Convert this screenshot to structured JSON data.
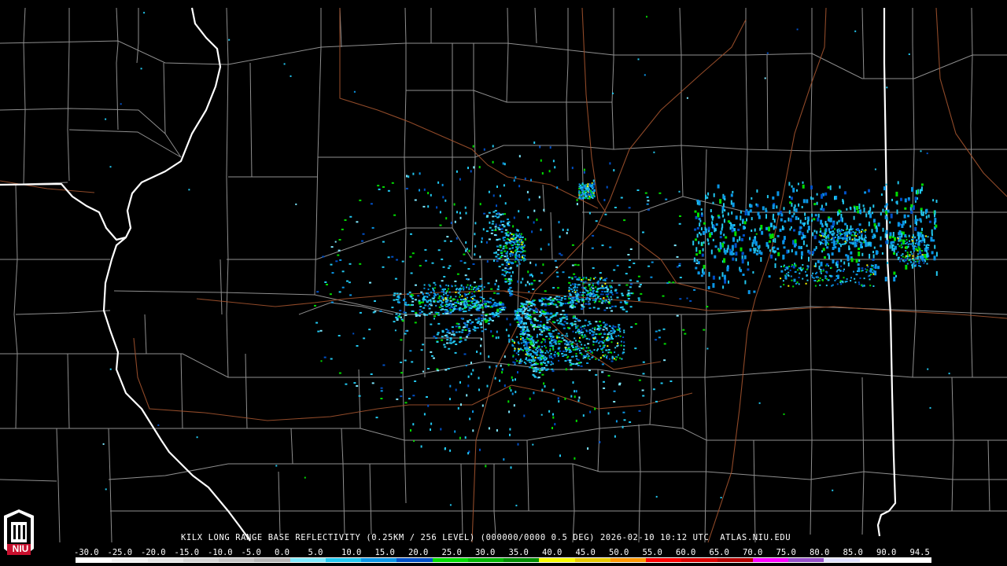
{
  "product": {
    "caption": "KILX LONG RANGE BASE REFLECTIVITY (0.25KM / 256 LEVEL) (000000/0000 0.5 DEG) 2026-02-10 10:12 UTC  ATLAS.NIU.EDU",
    "logo_text": "NIU"
  },
  "scale": {
    "labels": [
      "-30.0",
      "-25.0",
      "-20.0",
      "-15.0",
      "-10.0",
      "-5.0",
      "0.0",
      "5.0",
      "10.0",
      "15.0",
      "20.0",
      "25.0",
      "30.0",
      "35.0",
      "40.0",
      "45.0",
      "50.0",
      "55.0",
      "60.0",
      "65.0",
      "70.0",
      "75.0",
      "80.0",
      "85.0",
      "90.0",
      "94.5"
    ],
    "colors": [
      "#ffffff",
      "#f0f0f0",
      "#e4e4e4",
      "#d4d4d4",
      "#c4c4c4",
      "#b4b4b4",
      "#7ee8ff",
      "#22c8f0",
      "#0a96e6",
      "#0050c8",
      "#00dc00",
      "#00b400",
      "#008c00",
      "#fafa00",
      "#e6c800",
      "#ff9600",
      "#ff0000",
      "#dc0000",
      "#b40000",
      "#ff00ff",
      "#9650c8",
      "#e0e0ff",
      "#ffffff",
      "#ffffff"
    ]
  },
  "colors": {
    "county_lines": "#a8a8a8",
    "state_lines": "#ffffff",
    "highways": "#a0522d",
    "background": "#000000"
  }
}
